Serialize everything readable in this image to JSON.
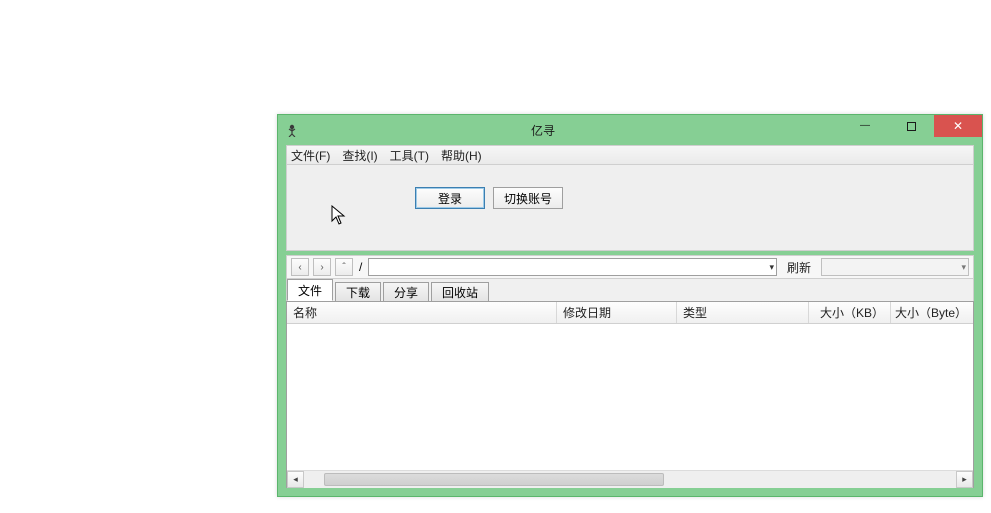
{
  "window": {
    "title": "亿寻"
  },
  "menu": {
    "file": "文件(F)",
    "find": "查找(I)",
    "tools": "工具(T)",
    "help": "帮助(H)"
  },
  "buttons": {
    "login": "登录",
    "switch_account": "切换账号"
  },
  "nav": {
    "back_glyph": "‹",
    "fwd_glyph": "›",
    "up_glyph": "ˆ",
    "path_label": "/",
    "refresh": "刷新"
  },
  "tabs": {
    "files": "文件",
    "downloads": "下载",
    "share": "分享",
    "recycle": "回收站"
  },
  "columns": {
    "name": "名称",
    "modified": "修改日期",
    "type": "类型",
    "size_kb": "大小（KB）",
    "size_byte": "大小（Byte）"
  }
}
